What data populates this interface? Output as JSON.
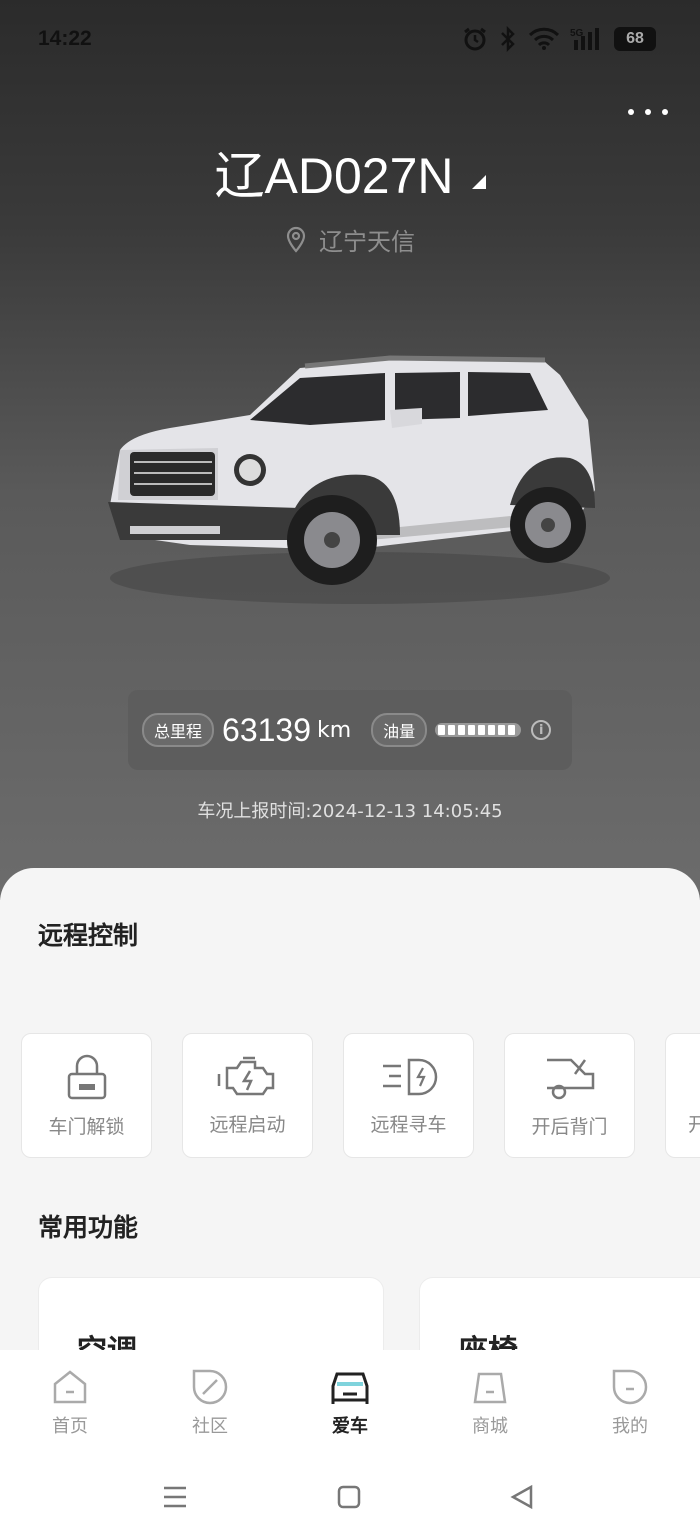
{
  "status_bar": {
    "time": "14:22",
    "battery": "68",
    "network": "5G"
  },
  "header": {
    "plate": "辽AD027N",
    "location": "辽宁天信"
  },
  "stats": {
    "mileage_label": "总里程",
    "mileage_value": "63139",
    "mileage_unit": "km",
    "fuel_label": "油量",
    "fuel_level": 0.9,
    "report_time": "车况上报时间:2024-12-13 14:05:45"
  },
  "remote": {
    "title": "远程控制",
    "items": [
      {
        "label": "车门解锁",
        "icon": "lock-icon"
      },
      {
        "label": "远程启动",
        "icon": "engine-icon"
      },
      {
        "label": "远程寻车",
        "icon": "headlight-icon"
      },
      {
        "label": "开后背门",
        "icon": "tailgate-icon"
      },
      {
        "label": "开",
        "icon": "unknown-icon"
      }
    ]
  },
  "common": {
    "title": "常用功能",
    "cards": [
      {
        "label": "空调"
      },
      {
        "label": "座椅"
      }
    ]
  },
  "tabbar": {
    "items": [
      {
        "label": "首页",
        "icon": "home-icon"
      },
      {
        "label": "社区",
        "icon": "community-icon"
      },
      {
        "label": "爱车",
        "icon": "car-icon",
        "active": true
      },
      {
        "label": "商城",
        "icon": "shop-icon"
      },
      {
        "label": "我的",
        "icon": "profile-icon"
      }
    ]
  },
  "colors": {
    "accent_active": "#222222",
    "inactive": "#999999",
    "hero_top": "#2b2b2b",
    "hero_bottom": "#6c6c6c"
  }
}
